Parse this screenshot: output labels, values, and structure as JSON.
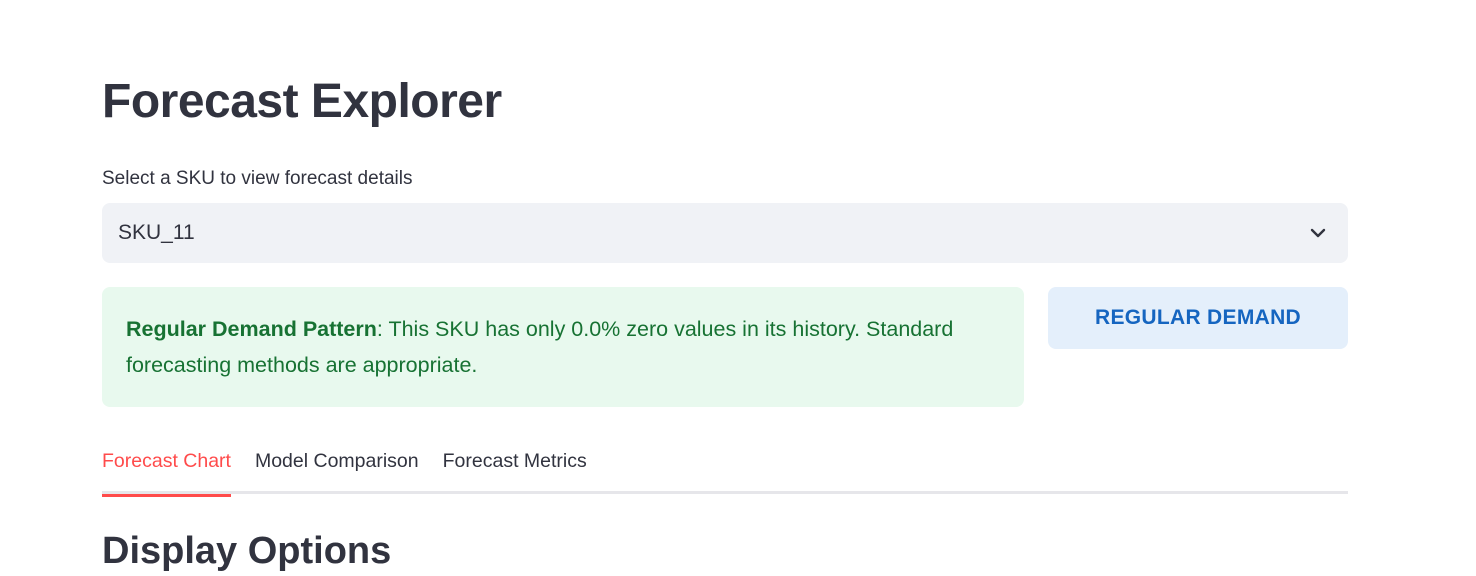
{
  "page": {
    "title": "Forecast Explorer"
  },
  "sku_select": {
    "label": "Select a SKU to view forecast details",
    "value": "SKU_11"
  },
  "alert": {
    "bold": "Regular Demand Pattern",
    "text": ": This SKU has only 0.0% zero values in its history. Standard forecasting methods are appropriate."
  },
  "badge": {
    "label": "REGULAR DEMAND"
  },
  "tabs": [
    {
      "label": "Forecast Chart",
      "active": true
    },
    {
      "label": "Model Comparison",
      "active": false
    },
    {
      "label": "Forecast Metrics",
      "active": false
    }
  ],
  "section": {
    "heading": "Display Options"
  },
  "colors": {
    "accent": "#ff4b4b",
    "success_bg": "#e8f9ee",
    "success_text": "#177233",
    "badge_bg": "#e4effb",
    "badge_text": "#1565c0"
  }
}
